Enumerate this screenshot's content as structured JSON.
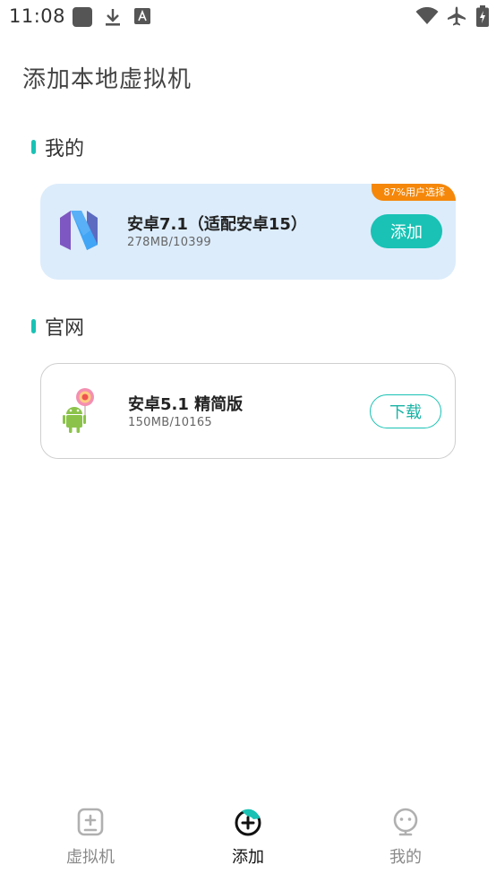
{
  "status_bar": {
    "time": "11:08",
    "icons": [
      "square-app-icon",
      "download-icon",
      "font-a-icon",
      "wifi-icon",
      "airplane-icon",
      "battery-charging-icon"
    ]
  },
  "page": {
    "title": "添加本地虚拟机"
  },
  "sections": [
    {
      "title": "我的",
      "cards": [
        {
          "badge": "87%用户选择",
          "logo": "android-nougat-logo-icon",
          "name": "安卓7.1（适配安卓15）",
          "meta": "278MB/10399",
          "button": "添加"
        }
      ]
    },
    {
      "title": "官网",
      "cards": [
        {
          "logo": "android-lollipop-logo-icon",
          "name": "安卓5.1 精简版",
          "meta": "150MB/10165",
          "button": "下载"
        }
      ]
    }
  ],
  "bottom_nav": {
    "items": [
      {
        "label": "虚拟机",
        "icon": "virtual-machine-icon",
        "active": false
      },
      {
        "label": "添加",
        "icon": "add-circle-icon",
        "active": true
      },
      {
        "label": "我的",
        "icon": "profile-icon",
        "active": false
      }
    ]
  },
  "colors": {
    "accent": "#19c2b4",
    "badge": "#f5870a",
    "card_highlight": "#dcecfb"
  }
}
